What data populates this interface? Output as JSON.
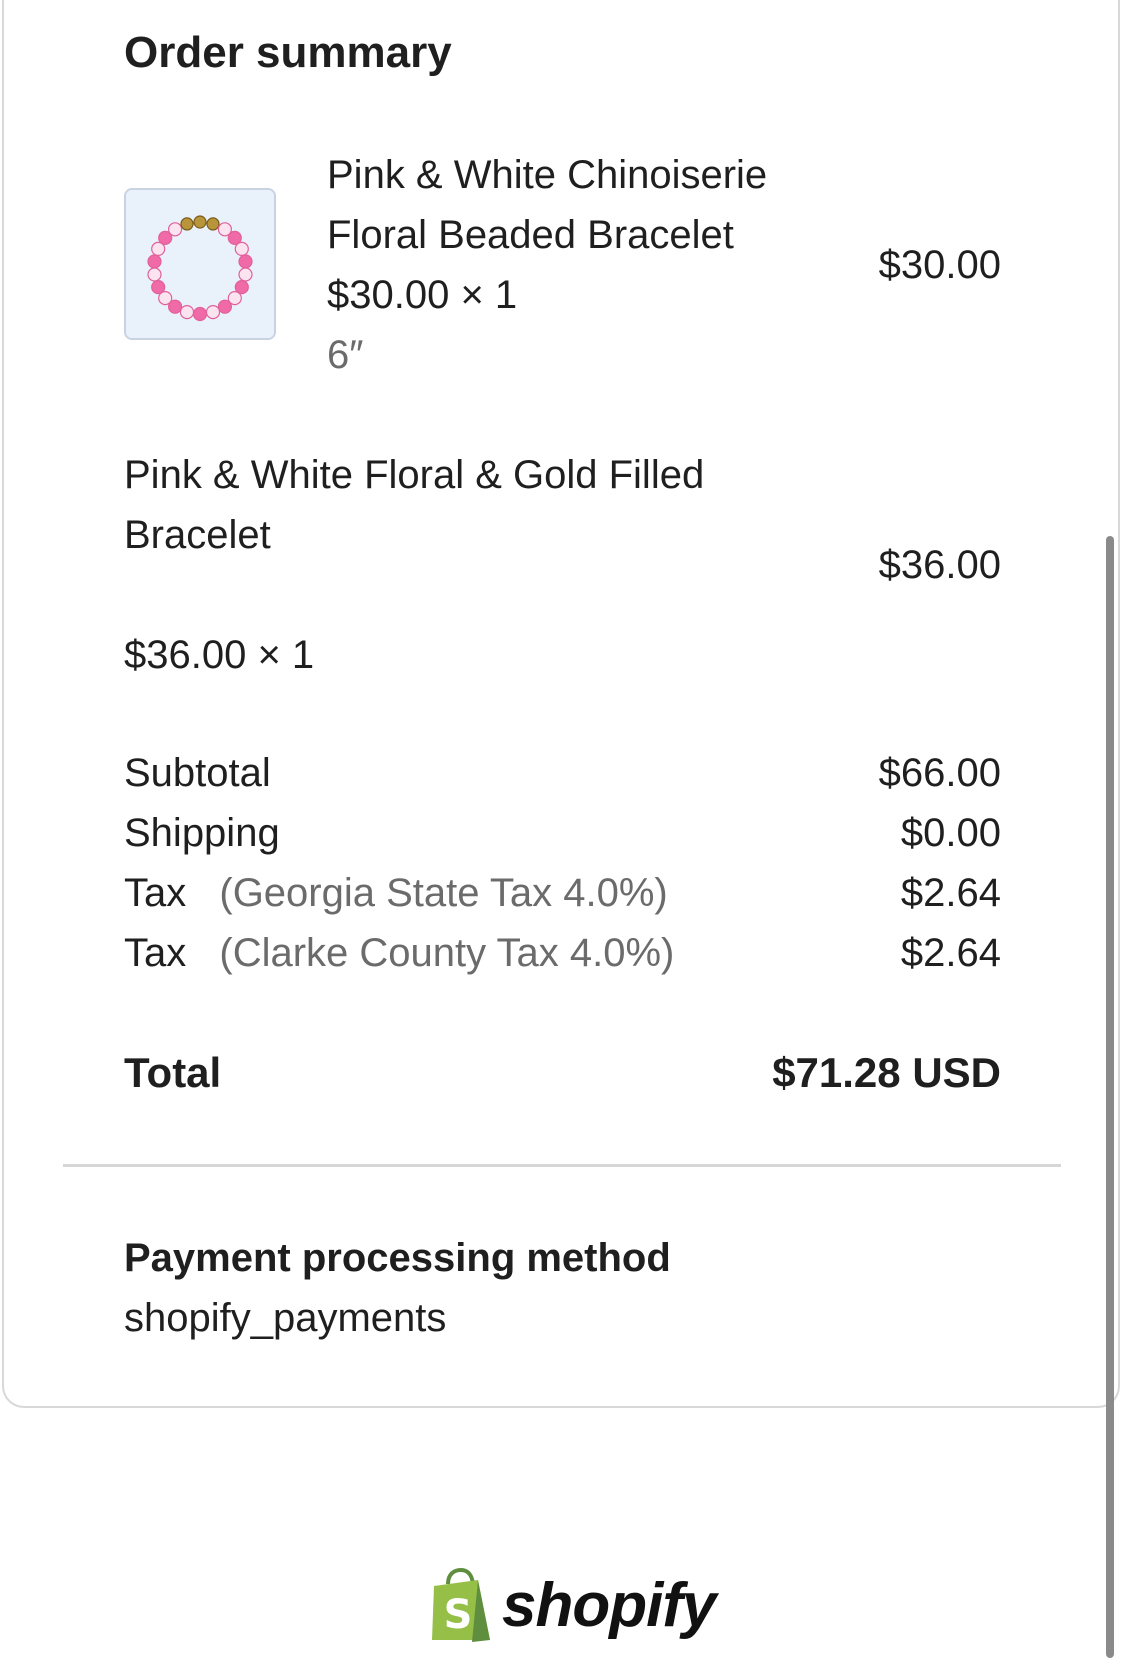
{
  "order_summary": {
    "title": "Order summary",
    "items": [
      {
        "name_line1": "Pink & White Chinoiserie",
        "name_line2": "Floral Beaded Bracelet",
        "unit_qty": "$30.00 × 1",
        "variant": "6″",
        "price": "$30.00"
      },
      {
        "name_line1": "Pink & White Floral & Gold Filled",
        "name_line2": "Bracelet",
        "unit_qty": "$36.00 × 1",
        "price": "$36.00"
      }
    ],
    "lines": {
      "subtotal_label": "Subtotal",
      "subtotal_value": "$66.00",
      "shipping_label": "Shipping",
      "shipping_value": "$0.00",
      "tax1_label": "Tax",
      "tax1_detail": "(Georgia State Tax 4.0%)",
      "tax1_value": "$2.64",
      "tax2_label": "Tax",
      "tax2_detail": "(Clarke County Tax 4.0%)",
      "tax2_value": "$2.64"
    },
    "total_label": "Total",
    "total_value": "$71.28 USD"
  },
  "payment": {
    "label": "Payment processing method",
    "value": "shopify_payments"
  },
  "footer": {
    "brand_icon": "shopify-bag-icon",
    "brand_name": "shopify",
    "brand_color": "#95BF47"
  }
}
